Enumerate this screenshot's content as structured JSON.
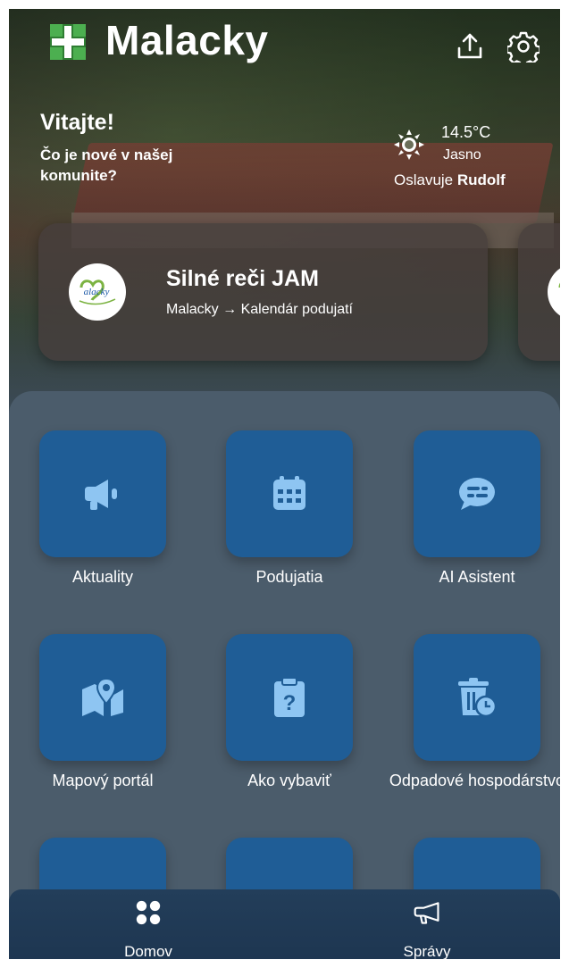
{
  "header": {
    "app_title": "Malacky",
    "logo_icon": "malacky-cross-logo-icon",
    "share_icon": "upload-share-icon",
    "settings_icon": "gear-icon"
  },
  "welcome": {
    "title": "Vitajte!",
    "subtitle": "Čo je nové v našej komunite?"
  },
  "weather": {
    "icon": "sun-icon",
    "temperature": "14.5°C",
    "condition": "Jasno",
    "nameday_prefix": "Oslavuje",
    "nameday_name": "Rudolf"
  },
  "featured_event": {
    "logo_text": "Malacky",
    "title": "Silné reči JAM",
    "path": "Malacky → Kalendár podujatí"
  },
  "tiles": [
    {
      "label": "Aktuality",
      "icon": "megaphone-icon"
    },
    {
      "label": "Podujatia",
      "icon": "calendar-icon"
    },
    {
      "label": "AI Asistent",
      "icon": "chat-bubble-icon"
    },
    {
      "label": "Mapový portál",
      "icon": "map-pin-icon"
    },
    {
      "label": "Ako vybaviť",
      "icon": "clipboard-question-icon"
    },
    {
      "label": "Odpadové hospodárstvo",
      "icon": "trash-clock-icon"
    }
  ],
  "bottom_nav": [
    {
      "label": "Domov",
      "icon": "dots-grid-icon"
    },
    {
      "label": "Správy",
      "icon": "megaphone-outline-icon"
    }
  ],
  "colors": {
    "tile": "#1f5d96",
    "panel": "#4b5c6b",
    "nav": "#1d3550",
    "logo_green": "#4caf50",
    "icon_light": "#8ec5f2"
  }
}
